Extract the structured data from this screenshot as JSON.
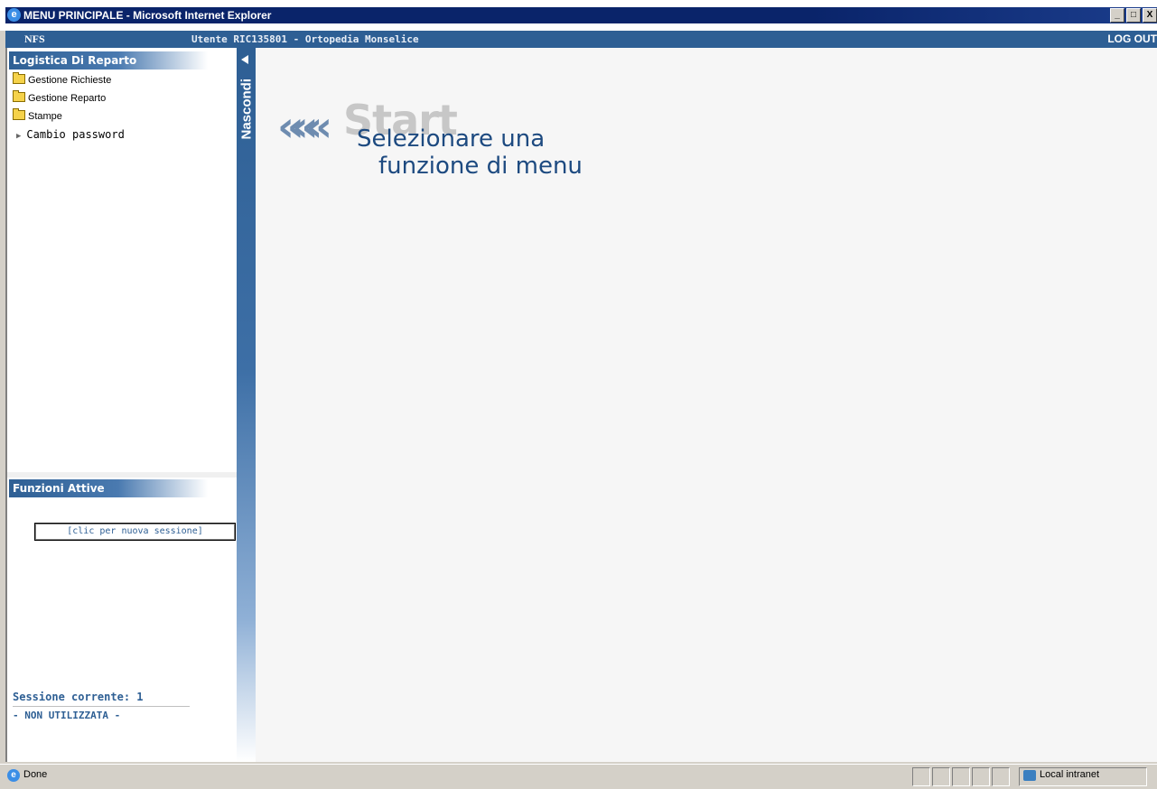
{
  "window": {
    "title": "MENU PRINCIPALE - Microsoft Internet Explorer",
    "controls": [
      "_",
      "□",
      "X"
    ]
  },
  "header": {
    "app_name": "NFS",
    "user_info": "Utente RIC135801 - Ortopedia Monselice",
    "logout_label": "LOG OUT"
  },
  "sidebar": {
    "section_title": "Logistica Di Reparto",
    "items": [
      {
        "label": "Gestione Richieste",
        "icon": "folder-icon"
      },
      {
        "label": "Gestione Reparto",
        "icon": "folder-icon"
      },
      {
        "label": "Stampe",
        "icon": "folder-icon"
      },
      {
        "label": "Cambio password",
        "icon": "arrow-right-icon"
      }
    ],
    "active_title": "Funzioni Attive",
    "new_session_label": "[clic per nuova sessione]",
    "session_label": "Sessione corrente: 1",
    "session_value": "- NON UTILIZZATA -"
  },
  "hidebar": {
    "label": "Nascondi"
  },
  "main": {
    "start_word": "Start",
    "prompt_line1": "Selezionare una",
    "prompt_line2": "funzione di menu"
  },
  "statusbar": {
    "status": "Done",
    "zone": "Local intranet"
  },
  "colors": {
    "accent": "#2e5f94",
    "titlebar": "#0a246a"
  }
}
